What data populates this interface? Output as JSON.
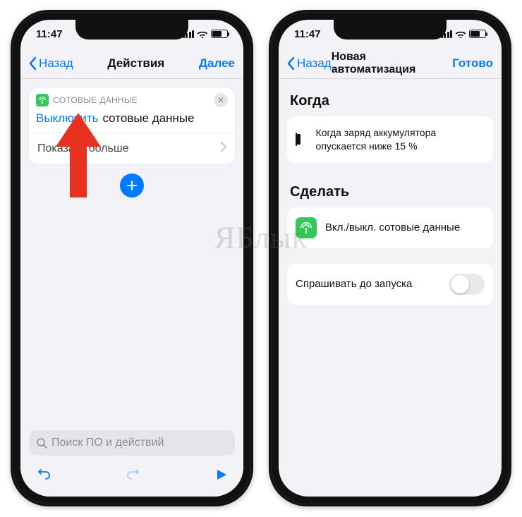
{
  "status": {
    "time": "11:47"
  },
  "left": {
    "back": "Назад",
    "title": "Действия",
    "next": "Далее",
    "badge": "СОТОВЫЕ ДАННЫЕ",
    "link": "Выключить",
    "text": "сотовые данные",
    "more": "Показать больше",
    "search_placeholder": "Поиск ПО и действий"
  },
  "right": {
    "back": "Назад",
    "title": "Новая автоматизация",
    "done": "Готово",
    "when": "Когда",
    "when_text": "Когда заряд аккумулятора опускается ниже 15 %",
    "do": "Сделать",
    "do_text": "Вкл./выкл. сотовые данные",
    "ask": "Спрашивать до запуска"
  },
  "watermark": "ЯБлык"
}
